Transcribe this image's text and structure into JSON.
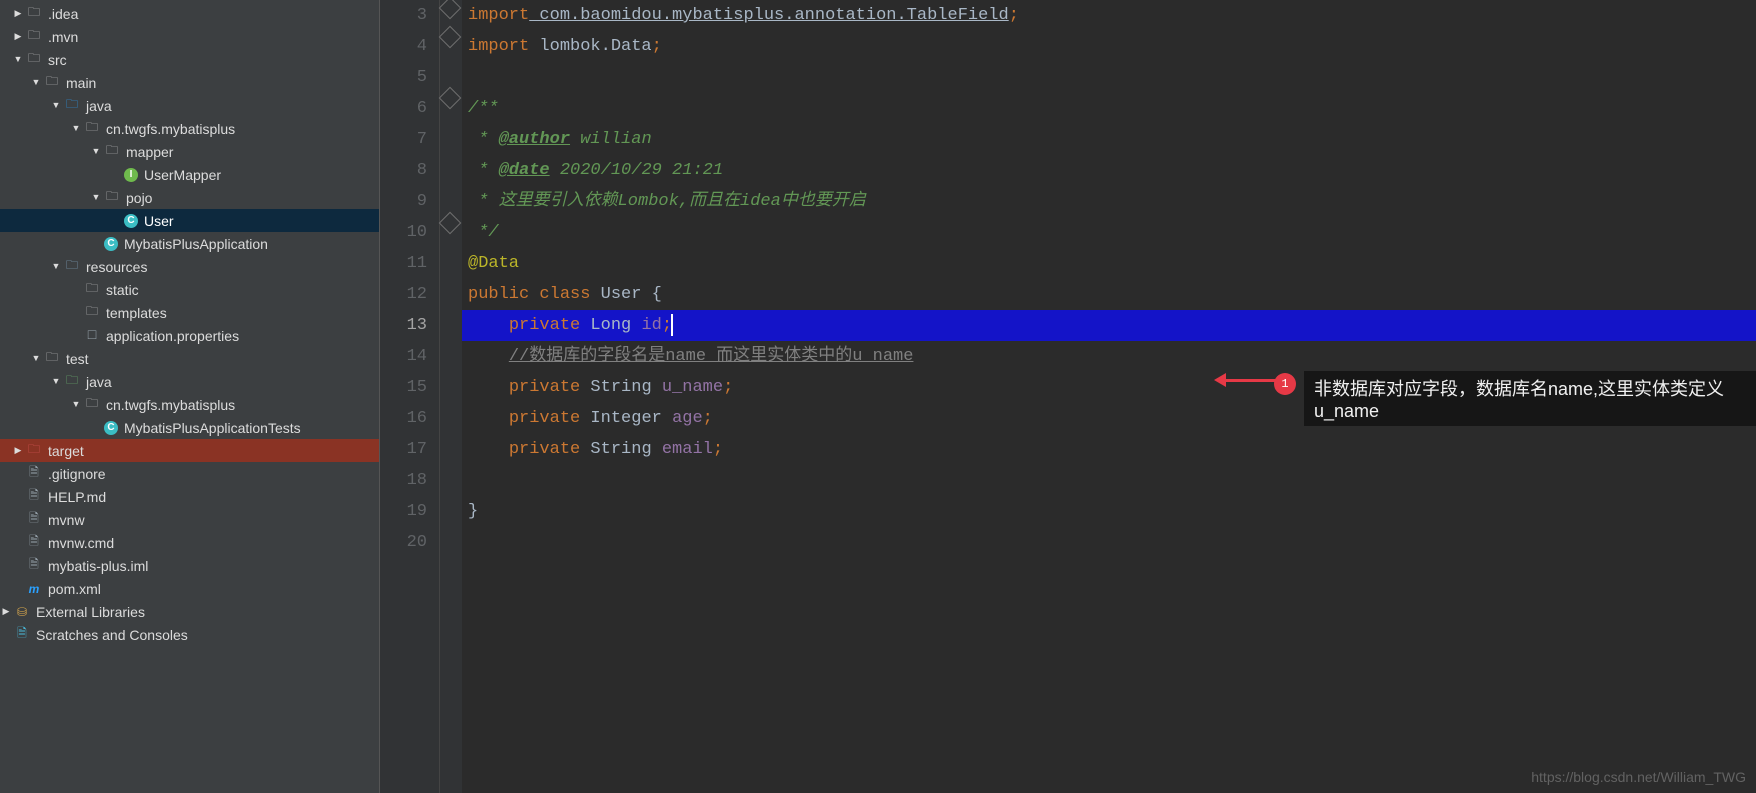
{
  "tree": {
    "idea": ".idea",
    "mvn": ".mvn",
    "src": "src",
    "main": "main",
    "java_main": "java",
    "pkg_main": "cn.twgfs.mybatisplus",
    "mapper": "mapper",
    "usermapper": "UserMapper",
    "pojo": "pojo",
    "user": "User",
    "app": "MybatisPlusApplication",
    "resources": "resources",
    "static": "static",
    "templates": "templates",
    "appprops": "application.properties",
    "test": "test",
    "java_test": "java",
    "pkg_test": "cn.twgfs.mybatisplus",
    "apptests": "MybatisPlusApplicationTests",
    "target": "target",
    "gitignore": ".gitignore",
    "helpmd": "HELP.md",
    "mvnw": "mvnw",
    "mvnwcmd": "mvnw.cmd",
    "iml": "mybatis-plus.iml",
    "pom": "pom.xml",
    "extlib": "External Libraries",
    "scratch": "Scratches and Consoles"
  },
  "gutter": [
    "3",
    "4",
    "5",
    "6",
    "7",
    "8",
    "9",
    "10",
    "11",
    "12",
    "13",
    "14",
    "15",
    "16",
    "17",
    "18",
    "19",
    "20"
  ],
  "code": {
    "l3_import": "import",
    "l3_pkg": " com.baomidou.mybatisplus.annotation.TableField",
    "l3_end": ";",
    "l4_import": "import",
    "l4_pkg": " lombok.Data",
    "l4_end": ";",
    "l6_open": "/**",
    "l7_star": " * ",
    "l7_tag": "@author",
    "l7_val": " willian",
    "l8_star": " * ",
    "l8_tag": "@date",
    "l8_val": " 2020/10/29 21:21",
    "l9": " * 这里要引入依赖Lombok,而且在idea中也要开启",
    "l10_close": " */",
    "l11_ann": "@Data",
    "l12_pub": "public",
    "l12_cls": " class",
    "l12_name": " User ",
    "l12_brace": "{",
    "l13_priv": "private",
    "l13_type": " Long ",
    "l13_field": "id",
    "l13_end": ";",
    "l14_cmt": "//数据库的字段名是name 而这里实体类中的u_name",
    "l15_priv": "private",
    "l15_type": " String ",
    "l15_field": "u_name",
    "l15_end": ";",
    "l16_priv": "private",
    "l16_type": " Integer ",
    "l16_field": "age",
    "l16_end": ";",
    "l17_priv": "private",
    "l17_type": " String ",
    "l17_field": "email",
    "l17_end": ";",
    "l19_brace": "}"
  },
  "annotation": {
    "num": "1",
    "text": "非数据库对应字段，数据库名name,这里实体类定义u_name"
  },
  "watermark": "https://blog.csdn.net/William_TWG"
}
